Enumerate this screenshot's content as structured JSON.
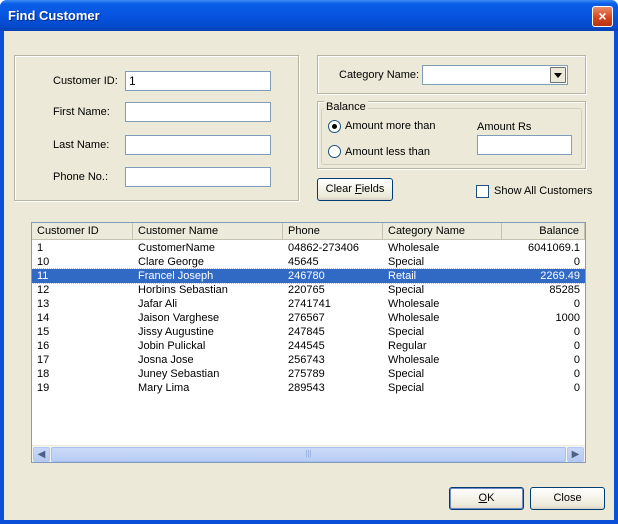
{
  "window": {
    "title": "Find Customer",
    "close_glyph": "×"
  },
  "search": {
    "customer_id_label": "Customer ID:",
    "customer_id_value": "1",
    "first_name_label": "First Name:",
    "first_name_value": "",
    "last_name_label": "Last Name:",
    "last_name_value": "",
    "phone_label": "Phone No.:",
    "phone_value": ""
  },
  "category": {
    "label": "Category Name:",
    "selected": ""
  },
  "balance": {
    "legend": "Balance",
    "more_than_label": "Amount more than",
    "less_than_label": "Amount less than",
    "selected": "more_than",
    "amount_label": "Amount  Rs",
    "amount_value": ""
  },
  "actions": {
    "clear_label": "Clear Fields",
    "show_all_label": "Show All Customers",
    "show_all_checked": false,
    "ok_label": "OK",
    "close_label": "Close"
  },
  "table": {
    "columns": [
      "Customer ID",
      "Customer Name",
      "Phone",
      "Category Name",
      "Balance"
    ],
    "selected_index": 2,
    "rows": [
      [
        "1",
        "CustomerName",
        "04862-273406",
        "Wholesale",
        "6041069.1"
      ],
      [
        "10",
        "Clare George",
        "45645",
        "Special",
        "0"
      ],
      [
        "11",
        "Francel Joseph",
        "246780",
        "Retail",
        "2269.49"
      ],
      [
        "12",
        "Horbins Sebastian",
        "220765",
        "Special",
        "85285"
      ],
      [
        "13",
        "Jafar Ali",
        "2741741",
        "Wholesale",
        "0"
      ],
      [
        "14",
        "Jaison Varghese",
        "276567",
        "Wholesale",
        "1000"
      ],
      [
        "15",
        "Jissy Augustine",
        "247845",
        "Special",
        "0"
      ],
      [
        "16",
        "Jobin Pulickal",
        "244545",
        "Regular",
        "0"
      ],
      [
        "17",
        "Josna Jose",
        "256743",
        "Wholesale",
        "0"
      ],
      [
        "18",
        "Juney Sebastian",
        "275789",
        "Special",
        "0"
      ],
      [
        "19",
        "Mary Lima",
        "289543",
        "Special",
        "0"
      ]
    ]
  },
  "scrollbar": {
    "left_glyph": "◀",
    "right_glyph": "▶",
    "thumb_grip": "|||"
  }
}
